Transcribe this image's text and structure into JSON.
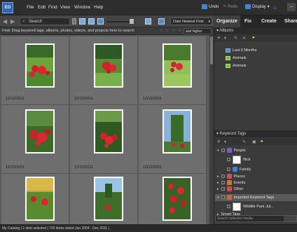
{
  "menubar": {
    "logo": "EO",
    "items": [
      "File",
      "Edit",
      "Find",
      "View",
      "Window",
      "Help"
    ],
    "undo": "Undo",
    "redo": "Redo",
    "display": "Display"
  },
  "toolbar": {
    "search_label": "Search",
    "sort": "Date Newest First"
  },
  "findbar": {
    "text": "Find: Drag keyword tags, albums, photos, videos, and projects here to search",
    "stars": "☆ ☆ ☆ ☆ ☆",
    "rating_filter": "and higher"
  },
  "tabs": [
    "Organize",
    "Fix",
    "Create",
    "Share"
  ],
  "albums": {
    "header": "Albums",
    "items": [
      "Last 6 Months",
      "Animals",
      "Animals"
    ]
  },
  "keywords": {
    "header": "Keyword Tags",
    "items": [
      {
        "label": "People",
        "color": "#7a5dc8"
      },
      {
        "label": "Nick",
        "color": "#ffffff"
      },
      {
        "label": "Family",
        "color": "#4a7fd0"
      },
      {
        "label": "Places",
        "color": "#d04c6c"
      },
      {
        "label": "Events",
        "color": "#c87a30"
      },
      {
        "label": "Other",
        "color": "#d04c4c"
      },
      {
        "label": "Imported Keyword Tags",
        "color": "#c86a30"
      },
      {
        "label": "Wildlife Park Jul...",
        "color": "#ffffff"
      }
    ],
    "smart_tags": "Smart Tags",
    "search_placeholder": "Search selected media"
  },
  "photos": [
    {
      "date": "12/12/2011",
      "rating": "☆☆☆☆☆"
    },
    {
      "date": "12/12/2011",
      "rating": "☆☆☆☆☆"
    },
    {
      "date": "12/12/2011",
      "rating": "☆☆☆☆☆"
    },
    {
      "date": "12/12/2011",
      "rating": "☆☆☆☆☆"
    },
    {
      "date": "12/12/2011",
      "rating": "☆☆☆☆☆"
    },
    {
      "date": "12/12/2011",
      "rating": "☆☆☆☆☆"
    },
    {
      "date": "",
      "rating": ""
    },
    {
      "date": "",
      "rating": ""
    },
    {
      "date": "",
      "rating": ""
    }
  ],
  "status": {
    "text": "My Catalog  |  1 item selected  |  720 items dated Jan 2004 - Dec 2011  |"
  },
  "colors": {
    "accent": "#3f86d8",
    "grid_bg": "#6e6e6e"
  }
}
